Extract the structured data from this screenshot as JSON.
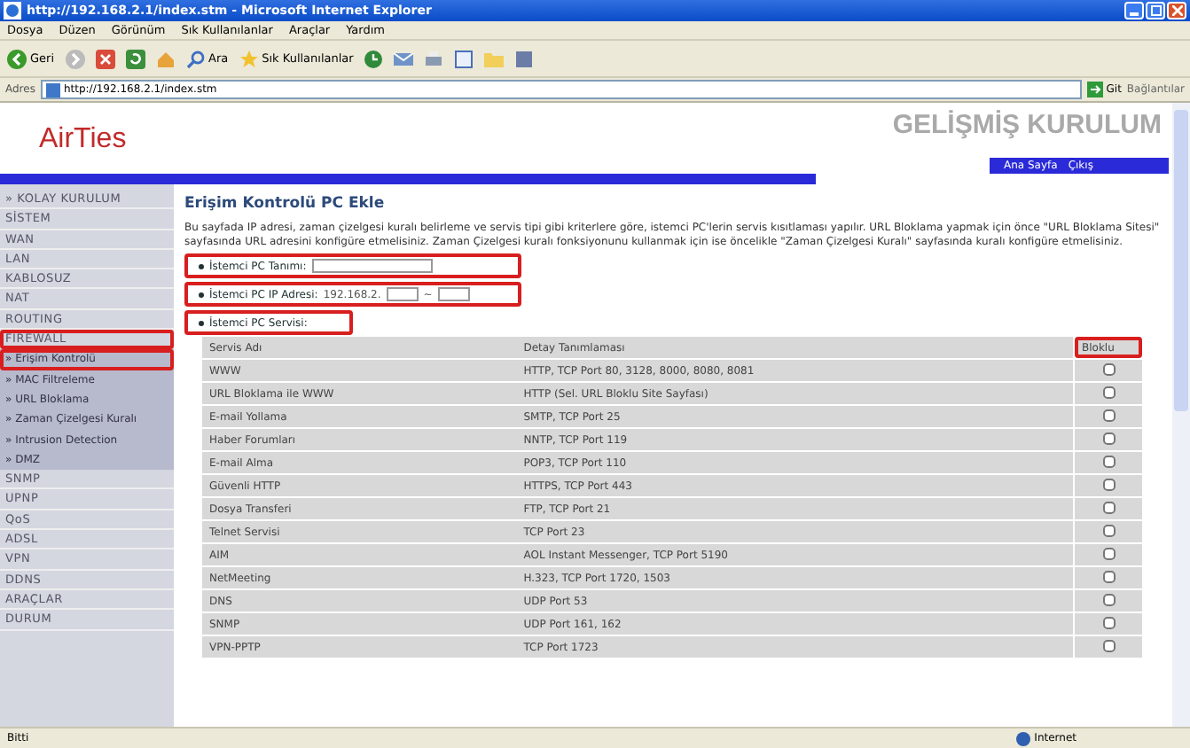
{
  "window": {
    "title": "http://192.168.2.1/index.stm - Microsoft Internet Explorer"
  },
  "menu": [
    "Dosya",
    "Düzen",
    "Görünüm",
    "Sık Kullanılanlar",
    "Araçlar",
    "Yardım"
  ],
  "toolbar": {
    "back": "Geri",
    "search": "Ara",
    "favorites": "Sık Kullanılanlar"
  },
  "address": {
    "label": "Adres",
    "url": "http://192.168.2.1/index.stm",
    "go": "Git",
    "links": "Bağlantılar"
  },
  "header": {
    "logo": "AirTies",
    "title": "GELİŞMİŞ KURULUM",
    "home": "Ana Sayfa",
    "logout": "Çıkış"
  },
  "sidebar": {
    "items": [
      {
        "label": "» KOLAY KURULUM",
        "highlighted": false
      },
      {
        "label": "SİSTEM",
        "highlighted": false
      },
      {
        "label": "WAN",
        "highlighted": false
      },
      {
        "label": "LAN",
        "highlighted": false
      },
      {
        "label": "KABLOSUZ",
        "highlighted": false
      },
      {
        "label": "NAT",
        "highlighted": false
      },
      {
        "label": "ROUTING",
        "highlighted": false
      },
      {
        "label": "FIREWALL",
        "highlighted": true,
        "children": [
          {
            "label": "» Erişim Kontrolü",
            "highlighted": true
          },
          {
            "label": "» MAC Filtreleme",
            "highlighted": false
          },
          {
            "label": "» URL Bloklama",
            "highlighted": false
          },
          {
            "label": "» Zaman Çizelgesi Kuralı",
            "highlighted": false
          },
          {
            "label": "» Intrusion Detection",
            "highlighted": false
          },
          {
            "label": "» DMZ",
            "highlighted": false
          }
        ]
      },
      {
        "label": "SNMP",
        "highlighted": false
      },
      {
        "label": "UPNP",
        "highlighted": false
      },
      {
        "label": "QoS",
        "highlighted": false
      },
      {
        "label": "ADSL",
        "highlighted": false
      },
      {
        "label": "VPN",
        "highlighted": false
      },
      {
        "label": "DDNS",
        "highlighted": false
      },
      {
        "label": "ARAÇLAR",
        "highlighted": false
      },
      {
        "label": "DURUM",
        "highlighted": false
      }
    ]
  },
  "content": {
    "title": "Erişim Kontrolü PC Ekle",
    "description": "Bu sayfada IP adresi, zaman çizelgesi kuralı belirleme ve servis tipi gibi kriterlere göre, istemci PC'lerin servis kısıtlaması yapılır. URL Bloklama yapmak için önce \"URL Bloklama Sitesi\" sayfasında URL adresini konfigüre etmelisiniz. Zaman Çizelgesi kuralı fonksiyonunu kullanmak için ise öncelikle \"Zaman Çizelgesi Kuralı\" sayfasında kuralı konfigüre etmelisiniz.",
    "fields": [
      {
        "kind": "text",
        "label": "İstemci PC Tanımı:",
        "highlighted": true
      },
      {
        "kind": "ip",
        "label": "İstemci PC IP Adresi:",
        "prefix": "192.168.2.",
        "separator": "~",
        "highlighted": true
      },
      {
        "kind": "heading",
        "label": "İstemci PC Servisi:",
        "highlighted": true
      }
    ],
    "table": {
      "columns": [
        {
          "label": "Servis Adı",
          "highlighted": false
        },
        {
          "label": "Detay Tanımlaması",
          "highlighted": false
        },
        {
          "label": "Bloklu",
          "highlighted": true
        }
      ],
      "rows": [
        {
          "name": "WWW",
          "detail": "HTTP, TCP Port 80, 3128, 8000, 8080, 8081",
          "checked": false
        },
        {
          "name": "URL Bloklama ile WWW",
          "detail": "HTTP (Sel. URL Bloklu Site Sayfası)",
          "checked": false
        },
        {
          "name": "E-mail Yollama",
          "detail": "SMTP, TCP Port 25",
          "checked": false
        },
        {
          "name": "Haber Forumları",
          "detail": "NNTP, TCP Port 119",
          "checked": false
        },
        {
          "name": "E-mail Alma",
          "detail": "POP3, TCP Port 110",
          "checked": false
        },
        {
          "name": "Güvenli HTTP",
          "detail": "HTTPS, TCP Port 443",
          "checked": false
        },
        {
          "name": "Dosya Transferi",
          "detail": "FTP, TCP Port 21",
          "checked": false
        },
        {
          "name": "Telnet Servisi",
          "detail": "TCP Port 23",
          "checked": false
        },
        {
          "name": "AIM",
          "detail": "AOL Instant Messenger, TCP Port 5190",
          "checked": false
        },
        {
          "name": "NetMeeting",
          "detail": "H.323, TCP Port 1720, 1503",
          "checked": false
        },
        {
          "name": "DNS",
          "detail": "UDP Port 53",
          "checked": false
        },
        {
          "name": "SNMP",
          "detail": "UDP Port 161, 162",
          "checked": false
        },
        {
          "name": "VPN-PPTP",
          "detail": "TCP Port 1723",
          "checked": false
        }
      ]
    }
  },
  "status_bar": {
    "left": "Bitti",
    "zone": "Internet"
  }
}
